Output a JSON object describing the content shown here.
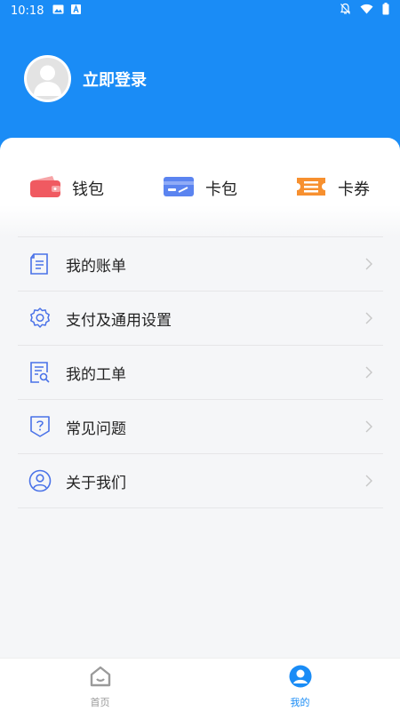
{
  "status_bar": {
    "time": "10:18",
    "left_icons": [
      "image-icon",
      "a-notification-icon"
    ],
    "right_icons": [
      "mute-bell-icon",
      "wifi-icon",
      "battery-icon"
    ]
  },
  "colors": {
    "header_blue": "#1a8cf6",
    "icon_blue": "#4a72e8",
    "wallet_red": "#f05a61",
    "card_blue": "#5b84f0",
    "coupon_orange": "#f7902f",
    "tab_active": "#1a8cf6",
    "tab_inactive": "#999999"
  },
  "profile": {
    "login_label": "立即登录",
    "avatar_icon": "default-avatar-icon"
  },
  "quick_actions": [
    {
      "label": "钱包",
      "icon": "wallet-icon"
    },
    {
      "label": "卡包",
      "icon": "card-pack-icon"
    },
    {
      "label": "卡券",
      "icon": "coupon-icon"
    }
  ],
  "menu": [
    {
      "label": "我的账单",
      "icon": "bill-icon"
    },
    {
      "label": "支付及通用设置",
      "icon": "settings-gear-icon"
    },
    {
      "label": "我的工单",
      "icon": "work-order-icon"
    },
    {
      "label": "常见问题",
      "icon": "faq-icon"
    },
    {
      "label": "关于我们",
      "icon": "about-user-icon"
    }
  ],
  "tabbar": {
    "tabs": [
      {
        "label": "首页",
        "icon": "home-icon",
        "active": false
      },
      {
        "label": "我的",
        "icon": "profile-icon",
        "active": true
      }
    ]
  }
}
